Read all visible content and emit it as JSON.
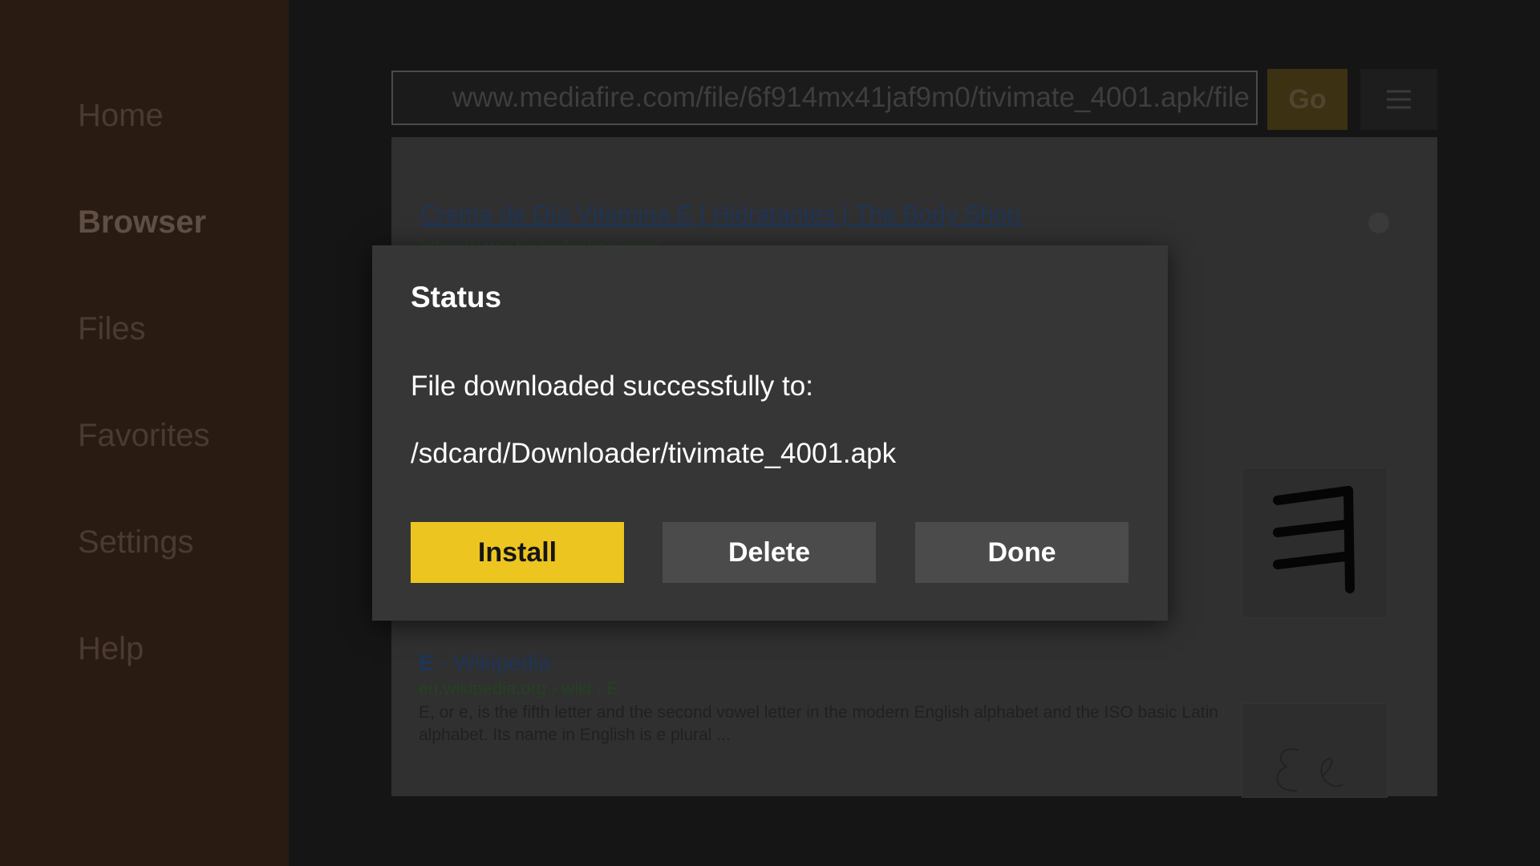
{
  "sidebar": {
    "items": [
      {
        "label": "Home"
      },
      {
        "label": "Browser"
      },
      {
        "label": "Files"
      },
      {
        "label": "Favorites"
      },
      {
        "label": "Settings"
      },
      {
        "label": "Help"
      }
    ],
    "active": "Browser"
  },
  "toolbar": {
    "url_value": "www.mediafire.com/file/6f914mx41jaf9m0/tivimate_4001.apk/file",
    "go_label": "Go",
    "menu_icon": "hamburger-menu-icon"
  },
  "webview": {
    "result1": {
      "title": "Crema de Día Vitamina E | Hidratantes | The Body Shop",
      "url": "https://www.thebodyshop.com/"
    },
    "result2": {
      "title_letter": "E",
      "title_rest": " - Wikipedia",
      "url": "en.wikipedia.org › wiki › E",
      "snippet": "E, or e, is the fifth letter and the second vowel letter in the modern English alphabet and the ISO basic Latin alphabet. Its name in English is e plural ..."
    }
  },
  "dialog": {
    "title": "Status",
    "message": "File downloaded successfully to:",
    "path": "/sdcard/Downloader/tivimate_4001.apk",
    "install_label": "Install",
    "delete_label": "Delete",
    "done_label": "Done"
  },
  "colors": {
    "accent": "#ecc521",
    "dialog_bg": "#363636",
    "sidebar_bg": "#2a1b12"
  }
}
